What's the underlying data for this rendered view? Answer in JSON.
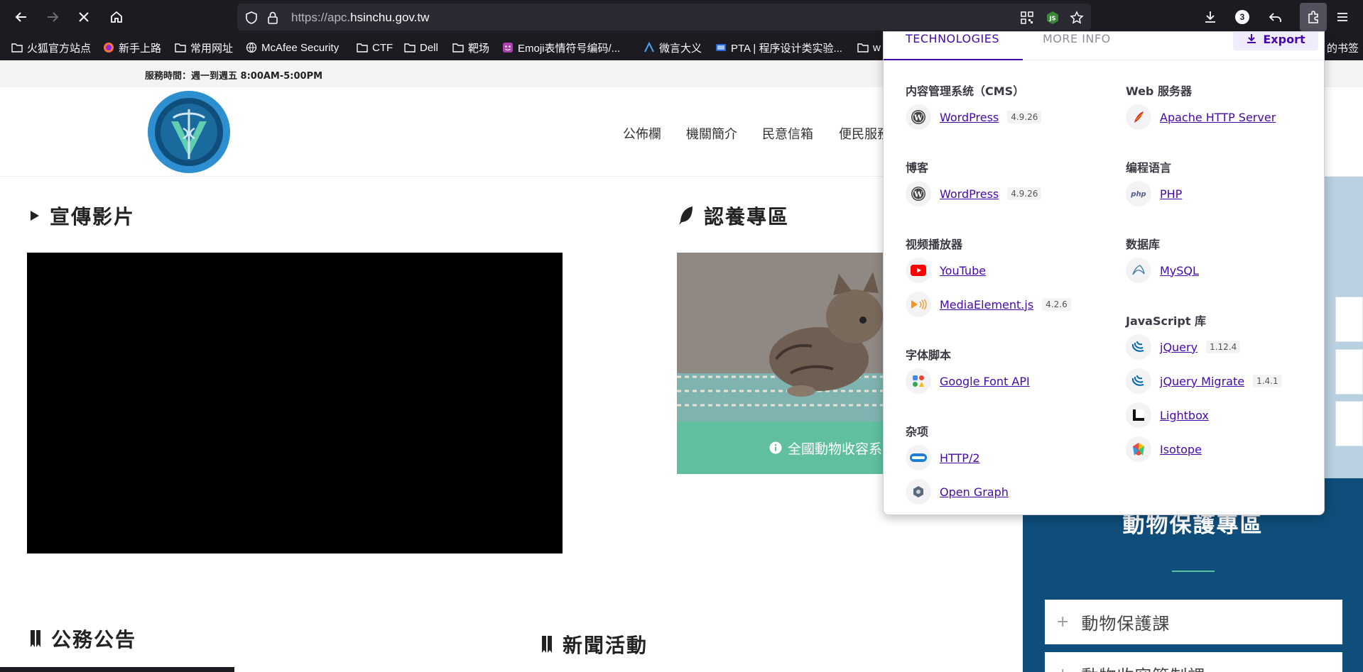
{
  "browser": {
    "url_prefix": "https://apc.",
    "url_host": "hsinchu.gov.tw",
    "downloads_badge": "3",
    "bookmarks": [
      {
        "label": "火狐官方站点",
        "icon": "folder-icon"
      },
      {
        "label": "新手上路",
        "icon": "firefox-icon"
      },
      {
        "label": "常用网址",
        "icon": "folder-icon"
      },
      {
        "label": "McAfee Security",
        "icon": "globe-icon"
      },
      {
        "label": "CTF",
        "icon": "folder-icon"
      },
      {
        "label": "Dell",
        "icon": "folder-icon"
      },
      {
        "label": "靶场",
        "icon": "folder-icon"
      },
      {
        "label": "Emoji表情符号编码/...",
        "icon": "emoji-icon"
      },
      {
        "label": "微言大义",
        "icon": "weiyan-icon"
      },
      {
        "label": "PTA | 程序设计类实验...",
        "icon": "pta-icon"
      },
      {
        "label": "w",
        "icon": "folder-icon"
      },
      {
        "label": "的书签",
        "icon": ""
      }
    ]
  },
  "page": {
    "service_hours": "服務時間：週一到週五 8:00AM-5:00PM",
    "nav": [
      "公佈欄",
      "機關簡介",
      "民意信箱",
      "便民服務"
    ],
    "sections": {
      "video": "宣傳影片",
      "adopt": "認養專區",
      "announcements": "公務公告",
      "news": "新聞活動"
    },
    "adopt_button": "全國動物收容系",
    "protect_title": "動物保護專區",
    "protect_items": [
      "動物保護課",
      "動物收容管制課"
    ]
  },
  "popup": {
    "tabs": [
      "TECHNOLOGIES",
      "MORE INFO"
    ],
    "export_label": "Export",
    "left_col": [
      {
        "category": "内容管理系统（CMS）",
        "items": [
          {
            "name": "WordPress",
            "version": "4.9.26",
            "icon": "wordpress-icon"
          }
        ]
      },
      {
        "category": "博客",
        "items": [
          {
            "name": "WordPress",
            "version": "4.9.26",
            "icon": "wordpress-icon"
          }
        ]
      },
      {
        "category": "视频播放器",
        "items": [
          {
            "name": "YouTube",
            "version": "",
            "icon": "youtube-icon"
          },
          {
            "name": "MediaElement.js",
            "version": "4.2.6",
            "icon": "mediaelement-icon"
          }
        ]
      },
      {
        "category": "字体脚本",
        "items": [
          {
            "name": "Google Font API",
            "version": "",
            "icon": "google-font-icon"
          }
        ]
      },
      {
        "category": "杂项",
        "items": [
          {
            "name": "HTTP/2",
            "version": "",
            "icon": "http2-icon"
          },
          {
            "name": "Open Graph",
            "version": "",
            "icon": "open-graph-icon"
          }
        ]
      }
    ],
    "right_col": [
      {
        "category": "Web 服务器",
        "items": [
          {
            "name": "Apache HTTP Server",
            "version": "",
            "icon": "apache-icon"
          }
        ]
      },
      {
        "category": "编程语言",
        "items": [
          {
            "name": "PHP",
            "version": "",
            "icon": "php-icon"
          }
        ]
      },
      {
        "category": "数据库",
        "items": [
          {
            "name": "MySQL",
            "version": "",
            "icon": "mysql-icon"
          }
        ]
      },
      {
        "category": "JavaScript 库",
        "items": [
          {
            "name": "jQuery",
            "version": "1.12.4",
            "icon": "jquery-icon"
          },
          {
            "name": "jQuery Migrate",
            "version": "1.4.1",
            "icon": "jquery-icon"
          },
          {
            "name": "Lightbox",
            "version": "",
            "icon": "lightbox-icon"
          },
          {
            "name": "Isotope",
            "version": "",
            "icon": "isotope-icon"
          }
        ]
      }
    ]
  }
}
